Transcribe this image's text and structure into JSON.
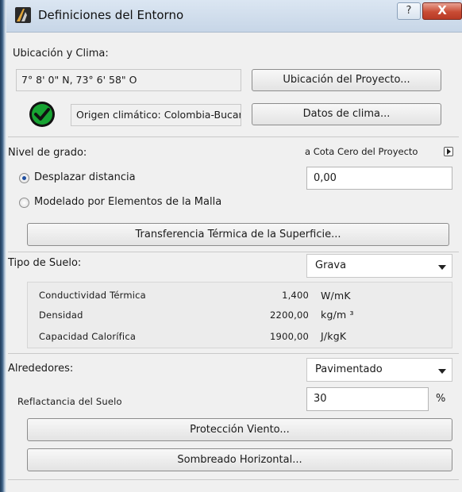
{
  "window": {
    "title": "Definiciones del Entorno",
    "help": "?",
    "close": "X"
  },
  "location": {
    "section_label": "Ubicación y Clima:",
    "coordinates": "7° 8' 0\" N, 73° 6' 58\" O",
    "project_location_button": "Ubicación del Proyecto...",
    "climate_origin": "Origen climático: Colombia-Bucar",
    "climate_data_button": "Datos de clima..."
  },
  "grade": {
    "label": "Nivel de grado:",
    "reference": "a Cota Cero del Proyecto",
    "option_offset": "Desplazar distancia",
    "option_mesh": "Modelado por Elementos de la Malla",
    "offset_value": "0,00",
    "selected_option": "Desplazar distancia"
  },
  "surface_transfer_button": "Transferencia Térmica de la Superficie...",
  "soil": {
    "label": "Tipo de Suelo:",
    "selected": "Grava",
    "properties": [
      {
        "name": "Conductividad Térmica",
        "value": "1,400",
        "unit": "W/mK"
      },
      {
        "name": "Densidad",
        "value": "2200,00",
        "unit": "kg/m ³"
      },
      {
        "name": "Capacidad Calorífica",
        "value": "1900,00",
        "unit": "J/kgK"
      }
    ]
  },
  "surroundings": {
    "label": "Alrededores:",
    "selected": "Pavimentado",
    "reflectance_label": "Reflactancia del Suelo",
    "reflectance_value": "30",
    "reflectance_unit": "%"
  },
  "wind_button": "Protección Viento...",
  "shading_button": "Sombreado Horizontal...",
  "icons": {
    "app": "archicad-logo-icon",
    "status": "green-checkmark-icon",
    "reference_arrow": "arrow-right-icon",
    "dropdown": "chevron-down-icon"
  },
  "colors": {
    "check_green": "#17a332",
    "titlebar": "#c7d6e7",
    "close_red": "#c94c35"
  }
}
